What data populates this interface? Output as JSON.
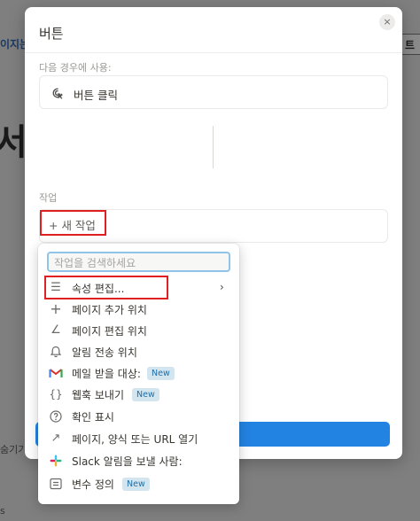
{
  "background": {
    "left_text": "이지는",
    "right_tab": "트",
    "big_glyph": "서",
    "bottom_left_1": "숨기기",
    "bottom_left_2": "s"
  },
  "modal": {
    "title": "버튼",
    "close_glyph": "×",
    "trigger_section_label": "다음 경우에 사용:",
    "trigger_label": "버튼 클릭",
    "action_section_label": "작업",
    "new_action_label": "+ 새 작업"
  },
  "menu": {
    "search_placeholder": "작업을 검색하세요",
    "new_badge": "New",
    "items": [
      {
        "label": "속성 편집...",
        "icon": "list-icon",
        "glyph": "☰"
      },
      {
        "label": "페이지 추가 위치",
        "icon": "plus-icon",
        "glyph": "+"
      },
      {
        "label": "페이지 편집 위치",
        "icon": "pencil-icon",
        "glyph": "∠"
      },
      {
        "label": "알림 전송 위치",
        "icon": "bell-icon",
        "glyph": "🔔"
      },
      {
        "label": "메일 받을 대상:",
        "icon": "gmail-icon",
        "glyph": "M"
      },
      {
        "label": "웹훅 보내기",
        "icon": "braces-icon",
        "glyph": "{}"
      },
      {
        "label": "확인 표시",
        "icon": "question-icon",
        "glyph": "?"
      },
      {
        "label": "페이지, 양식 또는 URL 열기",
        "icon": "arrow-up-right-icon",
        "glyph": "↗"
      },
      {
        "label": "Slack 알림을 보낼 사람:",
        "icon": "slack-icon",
        "glyph": "✱"
      },
      {
        "label": "변수 정의",
        "icon": "variable-icon",
        "glyph": "⊟"
      }
    ]
  },
  "colors": {
    "accent_blue": "#2383e2",
    "highlight_red": "#e02020",
    "gmail_red": "#d93025",
    "new_badge_bg": "#d3e5ef"
  }
}
